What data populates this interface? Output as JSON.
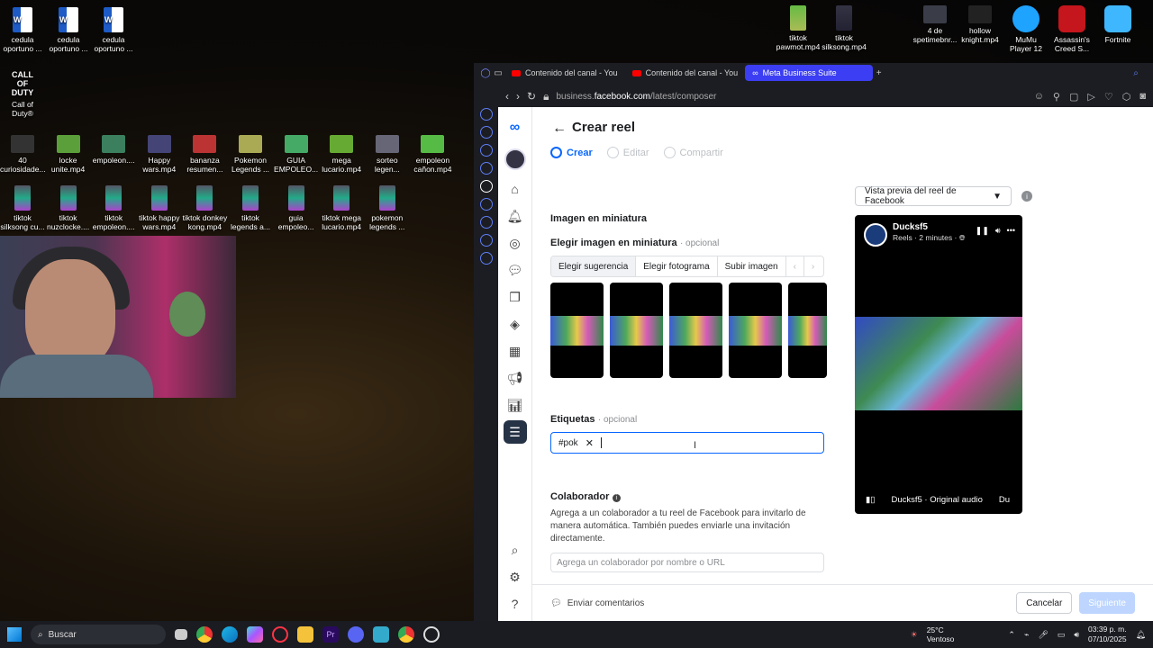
{
  "desktop": {
    "top_left_icons": [
      {
        "label": "cedula oportuno ..."
      },
      {
        "label": "cedula oportuno ..."
      },
      {
        "label": "cedula oportuno ..."
      }
    ],
    "call_of_duty": {
      "logo": "CALL OF DUTY",
      "label": "Call of Duty®"
    },
    "row1": [
      "40 curiosidade...",
      "locke unite.mp4",
      "empoleon....",
      "Happy wars.mp4",
      "bananza resumen...",
      "Pokemon Legends ...",
      "GUIA EMPOLEO...",
      "mega lucario.mp4",
      "sorteo legen...",
      "empoleon cañon.mp4"
    ],
    "row2": [
      "tiktok silksong cu...",
      "tiktok nuzclocke....",
      "tiktok empoleon....",
      "tiktok happy wars.mp4",
      "tiktok donkey kong.mp4",
      "tiktok legends a...",
      "guia empoleo...",
      "tiktok mega lucario.mp4",
      "pokemon legends ..."
    ],
    "top_right_icons": [
      "tiktok pawmot.mp4",
      "tiktok silksong.mp4",
      "4 de spetimebnr...",
      "hollow knight.mp4",
      "MuMu Player 12",
      "Assassin's Creed S...",
      "Fortnite"
    ]
  },
  "browser": {
    "tabs": [
      {
        "label": "Contenido del canal - You",
        "active": false
      },
      {
        "label": "Contenido del canal - You",
        "active": false
      },
      {
        "label": "Meta Business Suite",
        "active": true
      }
    ],
    "url_prefix": "business.",
    "url_domain": "facebook.com",
    "url_path": "/latest/composer"
  },
  "page": {
    "meta_logo": "∞",
    "title": "Crear reel",
    "steps": [
      {
        "label": "Crear",
        "active": true
      },
      {
        "label": "Editar",
        "active": false
      },
      {
        "label": "Compartir",
        "active": false
      }
    ],
    "thumbnail": {
      "section_title": "Imagen en miniatura",
      "choose_label": "Elegir imagen en miniatura",
      "optional": "opcional",
      "options": [
        "Elegir sugerencia",
        "Elegir fotograma",
        "Subir imagen"
      ],
      "selected_option": "Elegir sugerencia"
    },
    "tags": {
      "label": "Etiquetas",
      "optional": "opcional",
      "chip": "#pok",
      "chip_remove": "✕"
    },
    "collaborator": {
      "label": "Colaborador",
      "description": "Agrega a un colaborador a tu reel de Facebook para invitarlo de manera automática. También puedes enviarle una invitación directamente.",
      "placeholder": "Agrega un colaborador por nombre o URL"
    },
    "preview": {
      "select_label": "Vista previa del reel de Facebook",
      "account_name": "Ducksf5",
      "meta": "Reels · 2 minutes ·",
      "audio": "Ducksf5 · Original audio",
      "audio_cut": "Du"
    },
    "footer": {
      "feedback": "Enviar comentarios",
      "cancel": "Cancelar",
      "next": "Siguiente"
    }
  },
  "taskbar": {
    "search_label": "Buscar",
    "weather_temp": "25°C",
    "weather_desc": "Ventoso",
    "time": "03:39 p. m.",
    "date": "07/10/2025"
  }
}
